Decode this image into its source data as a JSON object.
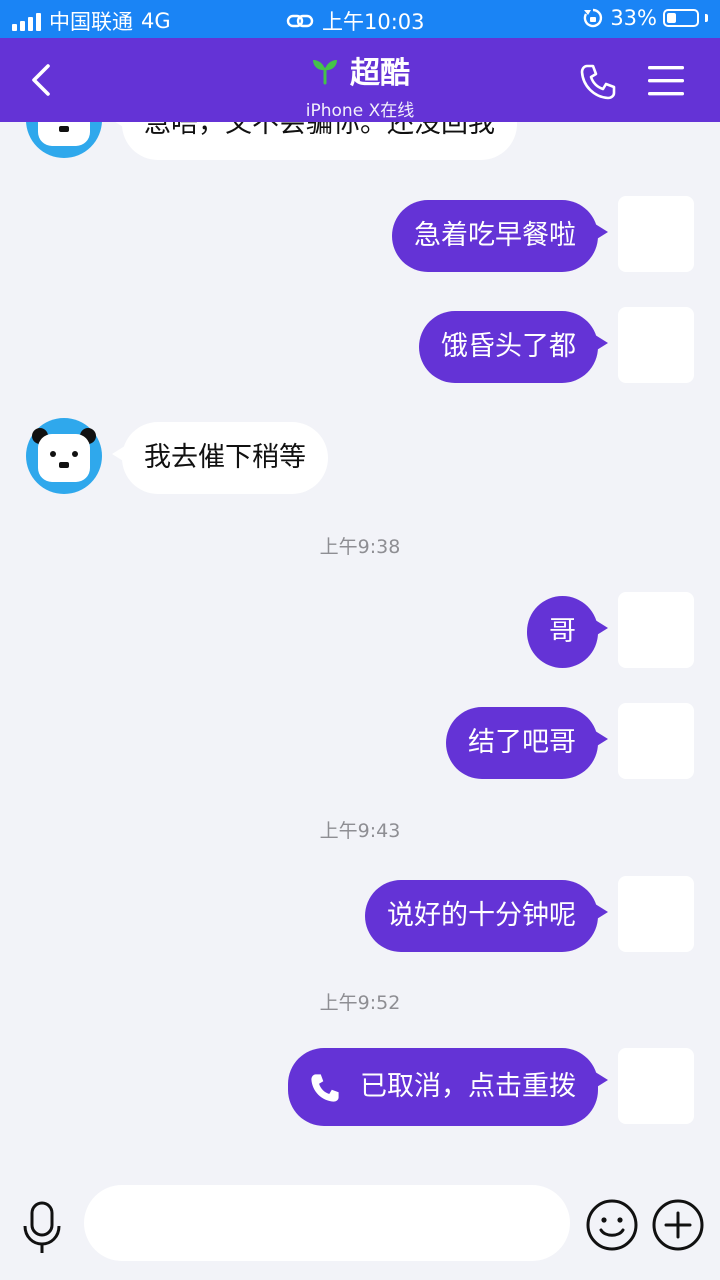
{
  "status_bar": {
    "carrier": "中国联通",
    "network": "4G",
    "time": "上午10:03",
    "battery": "33%",
    "battery_level": 0.33,
    "icons": [
      "signal-icon",
      "link-icon",
      "rotation-lock-icon",
      "battery-icon"
    ]
  },
  "header": {
    "title": "超酷",
    "subtitle": "iPhone X在线",
    "icons": [
      "back-icon",
      "sprout-icon",
      "phone-icon",
      "menu-icon"
    ]
  },
  "messages": {
    "m0": "急唔，又不会骗你。还没回我",
    "m1": "急着吃早餐啦",
    "m2": "饿昏头了都",
    "m3": "我去催下稍等",
    "t1": "上午9:38",
    "m4": "哥",
    "m5": "结了吧哥",
    "t2": "上午9:43",
    "m6": "说好的十分钟呢",
    "t3": "上午9:52",
    "m7": "已取消，点击重拨"
  },
  "input_bar": {
    "placeholder": "",
    "icons": [
      "microphone-icon",
      "smiley-icon",
      "plus-icon"
    ]
  },
  "colors": {
    "status_bar": "#1a84f5",
    "header": "#6433d6",
    "outgoing_bubble": "#6433d6",
    "incoming_bubble": "#ffffff",
    "background": "#f2f3f8"
  }
}
